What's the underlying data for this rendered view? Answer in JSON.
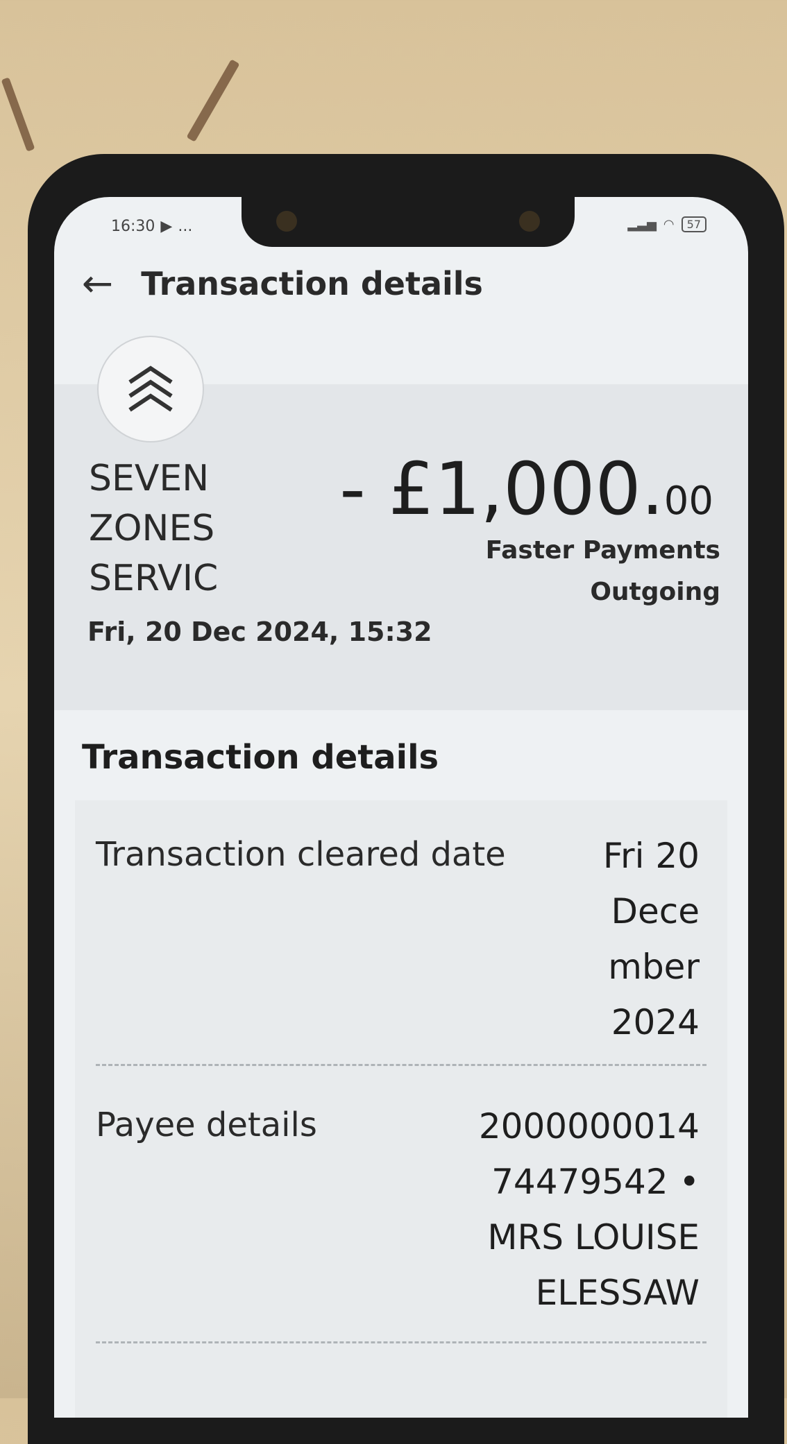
{
  "status_bar": {
    "time": "16:30",
    "dots": "...",
    "battery": "57"
  },
  "header": {
    "title": "Transaction details"
  },
  "summary": {
    "merchant_lines": [
      "SEVEN",
      "ZONES",
      "SERVIC"
    ],
    "amount_main": "- £1,000.",
    "amount_pence": "00",
    "payment_type_lines": [
      "Faster Payments",
      "Outgoing"
    ],
    "datetime": "Fri, 20 Dec 2024, 15:32"
  },
  "details": {
    "section_title": "Transaction details",
    "rows": [
      {
        "label": "Transaction cleared date",
        "value_lines": [
          "Fri 20",
          "Dece",
          "mber",
          "2024"
        ]
      },
      {
        "label": "Payee details",
        "value_lines": [
          "2000000014",
          "74479542 •",
          "MRS LOUISE",
          "ELESSAW"
        ]
      }
    ]
  },
  "icons": {
    "back": "back-arrow-icon",
    "logo": "chevrons-up-logo-icon"
  }
}
